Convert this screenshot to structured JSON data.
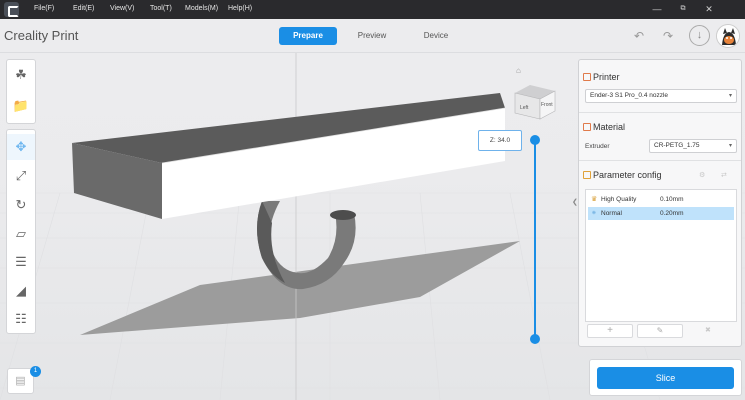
{
  "titlebar": {
    "menus": [
      "File(F)",
      "Edit(E)",
      "View(V)",
      "Tool(T)",
      "Models(M)",
      "Help(H)"
    ],
    "minimize_icon": "minimize-icon",
    "maximize_icon": "restore-icon",
    "close_icon": "close-icon"
  },
  "header": {
    "app_name": "Creality Print",
    "tabs": [
      {
        "label": "Prepare",
        "active": true
      },
      {
        "label": "Preview",
        "active": false
      },
      {
        "label": "Device",
        "active": false
      }
    ],
    "undo_icon": "undo-icon",
    "redo_icon": "redo-icon",
    "download_icon": "download-icon"
  },
  "viewport": {
    "z_value": "Z: 34.0",
    "view_cube": {
      "left_face": "Left",
      "front_face": "Front"
    }
  },
  "left_toolbar": {
    "top_group": [
      "add-model-icon",
      "open-folder-icon"
    ],
    "tools": [
      "move-icon",
      "scale-icon",
      "rotate-icon",
      "lay-on-face-icon",
      "layout-icon",
      "support-icon",
      "split-icon"
    ],
    "plate_count": "1"
  },
  "right_panel": {
    "printer": {
      "title": "Printer",
      "selected": "Ender-3 S1 Pro_0.4 nozzle"
    },
    "material": {
      "title": "Material",
      "extruder_label": "Extruder",
      "selected": "CR-PETG_1.75"
    },
    "parameter_config": {
      "title": "Parameter config",
      "rows": [
        {
          "name": "High Quality",
          "value": "0.10mm",
          "selected": false
        },
        {
          "name": "Normal",
          "value": "0.20mm",
          "selected": true
        }
      ]
    }
  },
  "slice": {
    "label": "Slice"
  },
  "colors": {
    "accent": "#1a8ee5",
    "titlebar": "#2a2a2d",
    "selected_row": "#bfe2fb"
  }
}
